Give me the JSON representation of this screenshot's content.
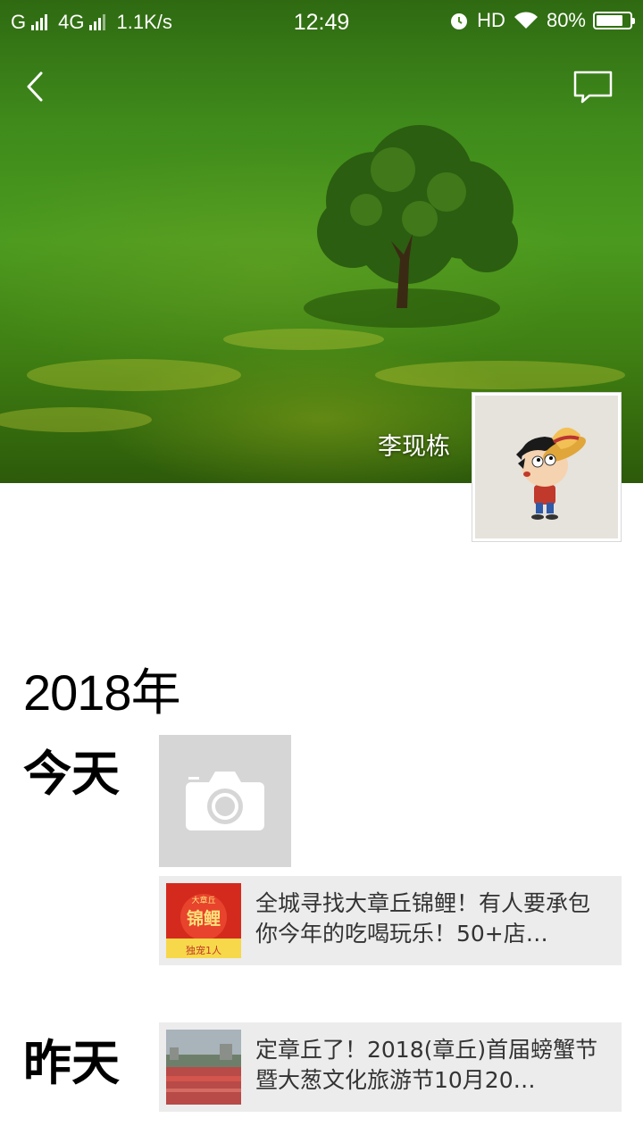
{
  "status_bar": {
    "carrier_1": "G",
    "carrier_2": "4G",
    "speed": "1.1K/s",
    "time": "12:49",
    "hd": "HD",
    "battery": "80%",
    "battery_level": 0.8
  },
  "nav": {
    "back_icon": "chevron-left-icon",
    "message_icon": "message-icon"
  },
  "profile": {
    "name": "李现栋"
  },
  "timeline": {
    "year": "2018年",
    "days": [
      {
        "label": "今天",
        "post_card": {
          "thumb_title": "大章丘",
          "thumb_main": "锦鲤",
          "thumb_footer": "独宠1人",
          "text": "全城寻找大章丘锦鲤！有人要承包你今年的吃喝玩乐！50+店…"
        }
      },
      {
        "label": "昨天",
        "post_card": {
          "text": "定章丘了！2018(章丘)首届螃蟹节暨大葱文化旅游节10月20…"
        }
      }
    ]
  },
  "colors": {
    "cover_green": "#3f8a1b",
    "card_bg": "#ececec",
    "camera_tile_bg": "#d6d6d6",
    "koi_red": "#d42a1e",
    "koi_gold": "#f7d84a"
  }
}
